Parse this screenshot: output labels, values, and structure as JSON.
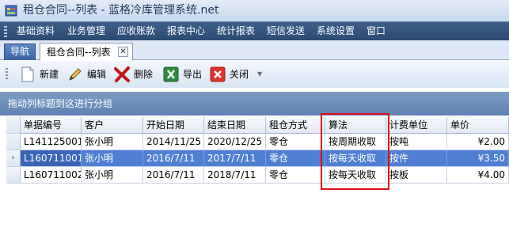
{
  "window": {
    "title": "租仓合同--列表 - 蓝格冷库管理系统.net"
  },
  "menu": {
    "items": [
      "基础资料",
      "业务管理",
      "应收账款",
      "报表中心",
      "统计报表",
      "短信发送",
      "系统设置",
      "窗口"
    ]
  },
  "tabs": {
    "nav_label": "导航",
    "active_label": "租仓合同--列表",
    "close_glyph": "✕"
  },
  "toolbar": {
    "new_label": "新建",
    "edit_label": "编辑",
    "delete_label": "删除",
    "export_label": "导出",
    "close_label": "关闭"
  },
  "group_panel": {
    "text": "拖动列标题到这进行分组"
  },
  "grid": {
    "columns": [
      "单据编号",
      "客户",
      "开始日期",
      "结束日期",
      "租仓方式",
      "算法",
      "计费单位",
      "单价"
    ],
    "rows": [
      [
        "L141125001",
        "张小明",
        "2014/11/25",
        "2020/12/25",
        "零仓",
        "按周期收取",
        "按吨",
        "¥2.00"
      ],
      [
        "L160711001",
        "张小明",
        "2016/7/11",
        "2017/7/11",
        "零仓",
        "按每天收取",
        "按件",
        "¥3.50"
      ],
      [
        "L160711002",
        "张小明",
        "2016/7/11",
        "2018/7/11",
        "零仓",
        "按每天收取",
        "按板",
        "¥4.00"
      ]
    ],
    "selected_row_indicator": "›"
  },
  "colors": {
    "menubar": "#2c4a72",
    "selection": "#4f7fd2",
    "highlight_box": "#e0101a"
  }
}
